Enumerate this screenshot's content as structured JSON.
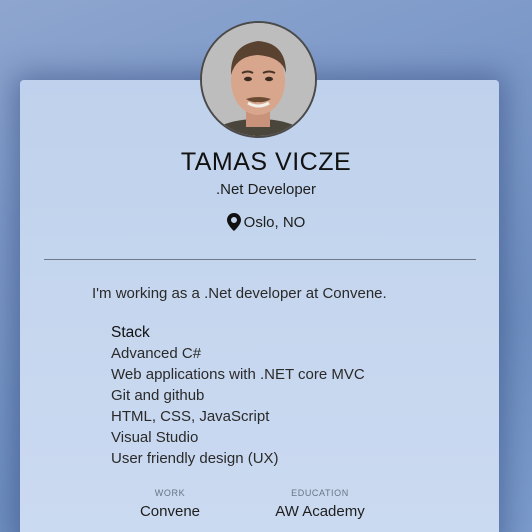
{
  "profile": {
    "name": "TAMAS VICZE",
    "role": ".Net Developer",
    "location": "Oslo, NO",
    "location_icon": "map-pin-icon",
    "intro": "I'm working as a .Net developer at Convene."
  },
  "stack": {
    "heading": "Stack",
    "items": [
      "Advanced C#",
      "Web applications with .NET core MVC",
      "Git and github",
      "HTML, CSS, JavaScript",
      "Visual Studio",
      "User friendly design (UX)"
    ]
  },
  "work": {
    "label": "WORK",
    "value": "Convene"
  },
  "education": {
    "label": "EDUCATION",
    "value": "AW Academy"
  },
  "colors": {
    "background": "#7a97c7",
    "card": "#c5d6ee",
    "text": "#1e1e1e"
  }
}
